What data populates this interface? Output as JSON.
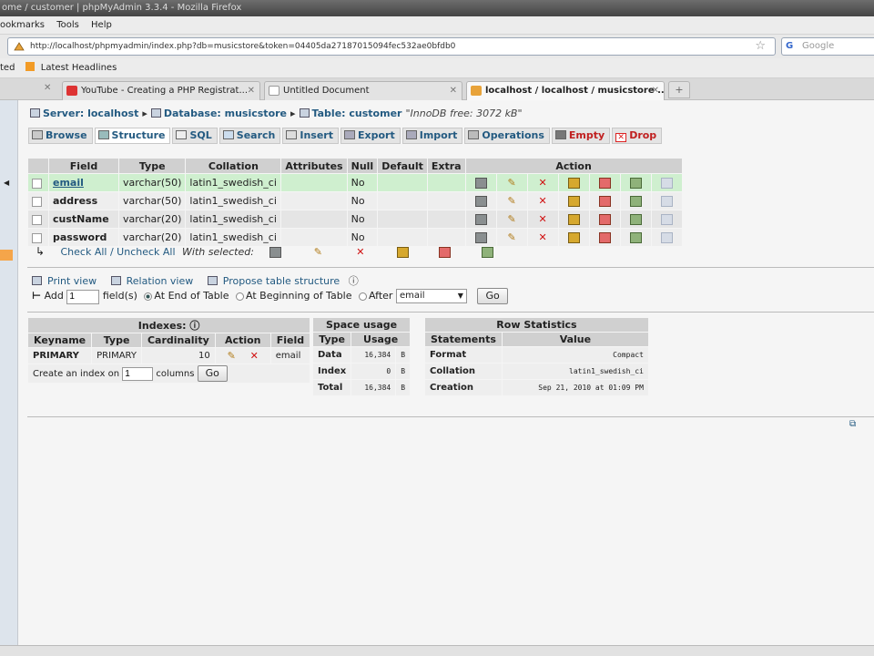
{
  "window": {
    "title": "ome / customer | phpMyAdmin 3.3.4 - Mozilla Firefox"
  },
  "menubar": {
    "items": [
      "ookmarks",
      "Tools",
      "Help"
    ]
  },
  "navbar": {
    "url": "http://localhost/phpmyadmin/index.php?db=musicstore&token=04405da27187015094fec532ae0bfdb0",
    "search_placeholder": "Google"
  },
  "bookmarks": {
    "left_text": "ted",
    "item": "Latest Headlines"
  },
  "browser_tabs": [
    {
      "label": "YouTube - Creating a PHP Registrat..."
    },
    {
      "label": "Untitled Document"
    },
    {
      "label": "localhost / localhost / musicstore ..."
    }
  ],
  "breadcrumb": {
    "server_label": "Server: localhost",
    "database_label": "Database: musicstore",
    "table_label": "Table: customer",
    "note": "\"InnoDB free: 3072 kB\""
  },
  "tabs": [
    "Browse",
    "Structure",
    "SQL",
    "Search",
    "Insert",
    "Export",
    "Import",
    "Operations",
    "Empty",
    "Drop"
  ],
  "structure": {
    "headers": [
      "Field",
      "Type",
      "Collation",
      "Attributes",
      "Null",
      "Default",
      "Extra",
      "Action"
    ],
    "rows": [
      {
        "field": "email",
        "type": "varchar(50)",
        "collation": "latin1_swedish_ci",
        "attributes": "",
        "null": "No",
        "default": "",
        "extra": ""
      },
      {
        "field": "address",
        "type": "varchar(50)",
        "collation": "latin1_swedish_ci",
        "attributes": "",
        "null": "No",
        "default": "",
        "extra": ""
      },
      {
        "field": "custName",
        "type": "varchar(20)",
        "collation": "latin1_swedish_ci",
        "attributes": "",
        "null": "No",
        "default": "",
        "extra": ""
      },
      {
        "field": "password",
        "type": "varchar(20)",
        "collation": "latin1_swedish_ci",
        "attributes": "",
        "null": "No",
        "default": "",
        "extra": ""
      }
    ],
    "check_all": "Check All / Uncheck All",
    "with_selected": "With selected:"
  },
  "tools": {
    "print_view": "Print view",
    "relation_view": "Relation view",
    "propose": "Propose table structure"
  },
  "add_fields": {
    "add_label": "Add",
    "count": "1",
    "fields_label": "field(s)",
    "at_end": "At End of Table",
    "at_beginning": "At Beginning of Table",
    "after": "After",
    "after_field": "email",
    "go": "Go"
  },
  "indexes": {
    "title": "Indexes:",
    "headers": [
      "Keyname",
      "Type",
      "Cardinality",
      "Action",
      "Field"
    ],
    "row": {
      "keyname": "PRIMARY",
      "type": "PRIMARY",
      "cardinality": "10",
      "field": "email"
    },
    "create_prefix": "Create an index on",
    "create_count": "1",
    "create_suffix": "columns",
    "go": "Go"
  },
  "space_usage": {
    "title": "Space usage",
    "headers": [
      "Type",
      "Usage"
    ],
    "rows": [
      {
        "type": "Data",
        "value": "16,384",
        "unit": "B"
      },
      {
        "type": "Index",
        "value": "0",
        "unit": "B"
      },
      {
        "type": "Total",
        "value": "16,384",
        "unit": "B"
      }
    ]
  },
  "row_statistics": {
    "title": "Row Statistics",
    "headers": [
      "Statements",
      "Value"
    ],
    "rows": [
      {
        "statement": "Format",
        "value": "Compact"
      },
      {
        "statement": "Collation",
        "value": "latin1_swedish_ci"
      },
      {
        "statement": "Creation",
        "value": "Sep 21, 2010 at 01:09 PM"
      }
    ]
  }
}
